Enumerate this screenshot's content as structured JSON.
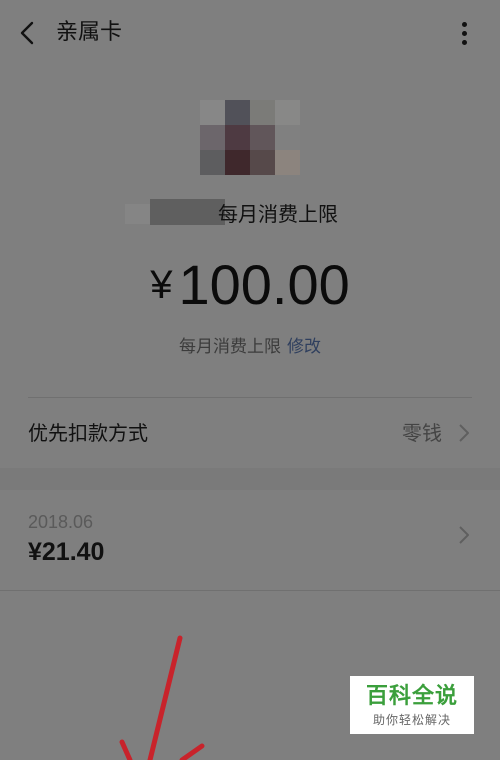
{
  "header": {
    "title": "亲属卡"
  },
  "limit": {
    "label": "每月消费上限",
    "currency": "¥",
    "amount": "100.00",
    "row_label": "每月消费上限",
    "edit_label": "修改"
  },
  "payment": {
    "label": "优先扣款方式",
    "value": "零钱"
  },
  "bill": {
    "month": "2018.06",
    "amount": "¥21.40"
  },
  "watermark": {
    "main": "百科全说",
    "sub": "助你轻松解决"
  },
  "colors": {
    "link": "#2f3f5e",
    "watermark_green": "#3b9f3c",
    "overlay_red": "#c8232b"
  },
  "icons": [
    "back-arrow-icon",
    "more-vertical-icon",
    "chevron-right-icon"
  ]
}
